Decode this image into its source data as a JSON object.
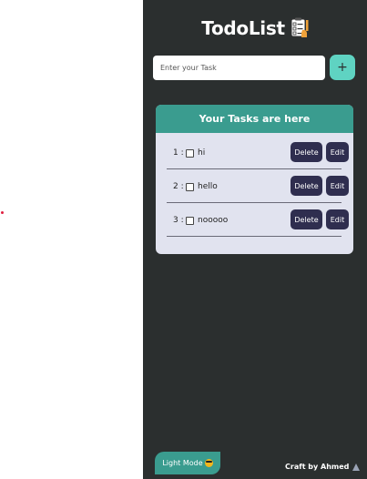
{
  "app": {
    "title": "TodoList",
    "title_icon": "clipboard-checklist-icon"
  },
  "input": {
    "placeholder": "Enter your Task",
    "value": "",
    "add_label": "+",
    "add_icon": "plus-icon"
  },
  "tasks": {
    "header": "Your Tasks are here",
    "items": [
      {
        "number": "1 :",
        "text": "hi",
        "delete_label": "Delete",
        "edit_label": "Edit",
        "checked": false
      },
      {
        "number": "2 :",
        "text": "hello",
        "delete_label": "Delete",
        "edit_label": "Edit",
        "checked": false
      },
      {
        "number": "3 :",
        "text": "nooooo",
        "delete_label": "Delete",
        "edit_label": "Edit",
        "checked": false
      }
    ]
  },
  "footer": {
    "light_mode_label": "Light Mode",
    "light_mode_icon": "cool-face-icon",
    "credit": "Craft by Ahmed",
    "credit_icon": "ninja-icon"
  },
  "colors": {
    "background": "#2b2f2f",
    "accent": "#3a9c8f",
    "add_button": "#5fd3c2",
    "card": "#e1e3ef",
    "task_button": "#2f2e4f"
  }
}
